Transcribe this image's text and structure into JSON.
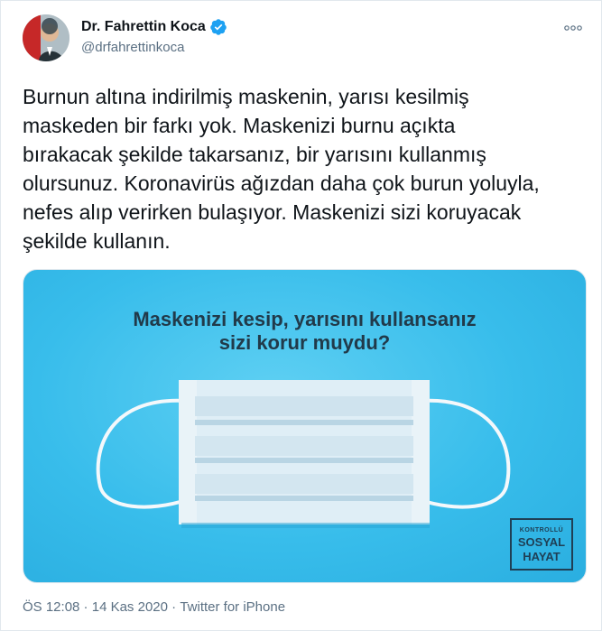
{
  "user": {
    "display_name": "Dr. Fahrettin Koca",
    "handle": "@drfahrettinkoca",
    "verified": true,
    "avatar_icon": "profile-photo"
  },
  "tweet": {
    "text": "Burnun altına indirilmiş maskenin, yarısı kesilmiş\nmaskeden bir farkı yok. Maskenizi burnu açıkta\nbırakacak şekilde takarsanız, bir yarısını kullanmış\nolursunuz. Koronavirüs ağızdan daha çok burun yoluyla,\nnefes alıp verirken bulaşıyor. Maskenizi sizi koruyacak\nşekilde kullanın."
  },
  "media": {
    "headline_line1": "Maskenizi kesip, yarısını kullansanız",
    "headline_line2": "sizi korur muydu?",
    "logo_line1": "KONTROLLÜ",
    "logo_line2": "SOSYAL",
    "logo_line3": "HAYAT",
    "background_color": "#38bdeb"
  },
  "meta": {
    "time": "ÖS 12:08",
    "separator": " · ",
    "date": "14 Kas 2020",
    "source": "Twitter for iPhone"
  },
  "icons": {
    "verified": "verified-badge-icon",
    "more": "more-options-icon"
  },
  "colors": {
    "verified_blue": "#1da1f2",
    "secondary_text": "#5b7083"
  }
}
